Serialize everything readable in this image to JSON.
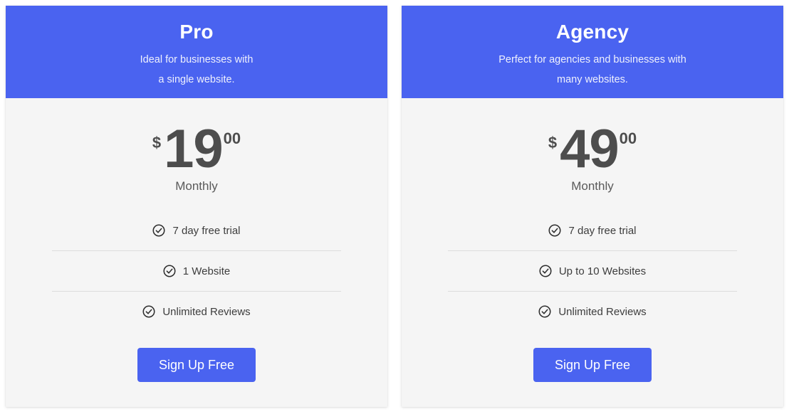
{
  "theme": {
    "accent_color": "#4a63f0",
    "card_body_color": "#f5f5f5",
    "price_color": "#4d4d4d",
    "divider_color": "#dddddd",
    "page_background": "#ffffff"
  },
  "plans": [
    {
      "title": "Pro",
      "description_line1": "Ideal for businesses with",
      "description_line2": "a single website.",
      "price": {
        "currency": "$",
        "amount": "19",
        "cents": "00",
        "period": "Monthly"
      },
      "features": [
        {
          "icon": "check-circle-icon",
          "label": "7 day free trial"
        },
        {
          "icon": "check-circle-icon",
          "label": "1 Website"
        },
        {
          "icon": "check-circle-icon",
          "label": "Unlimited Reviews"
        }
      ],
      "cta_label": "Sign Up Free"
    },
    {
      "title": "Agency",
      "description_line1": "Perfect for agencies and businesses with",
      "description_line2": "many websites.",
      "price": {
        "currency": "$",
        "amount": "49",
        "cents": "00",
        "period": "Monthly"
      },
      "features": [
        {
          "icon": "check-circle-icon",
          "label": "7 day free trial"
        },
        {
          "icon": "check-circle-icon",
          "label": "Up to 10 Websites"
        },
        {
          "icon": "check-circle-icon",
          "label": "Unlimited Reviews"
        }
      ],
      "cta_label": "Sign Up Free"
    }
  ]
}
